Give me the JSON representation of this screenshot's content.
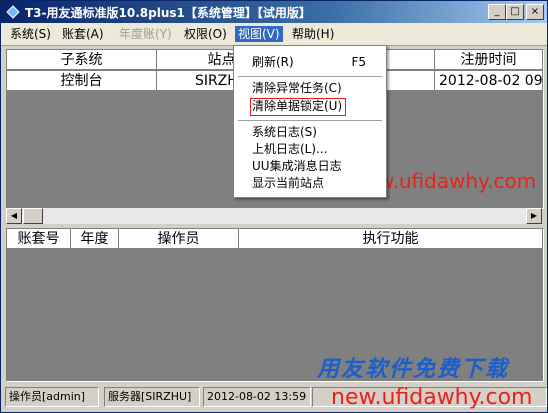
{
  "window": {
    "title": "T3-用友通标准版10.8plus1【系统管理】【试用版】",
    "buttons": {
      "minimize": "_",
      "maximize": "□",
      "close": "×"
    }
  },
  "menubar": {
    "items": [
      {
        "label": "系统(S)",
        "enabled": true
      },
      {
        "label": "账套(A)",
        "enabled": true
      },
      {
        "label": "年度账(Y)",
        "enabled": false
      },
      {
        "label": "权限(O)",
        "enabled": true
      },
      {
        "label": "视图(V)",
        "enabled": true,
        "active": true
      },
      {
        "label": "帮助(H)",
        "enabled": true
      }
    ]
  },
  "view_menu": {
    "items": [
      {
        "label": "刷新(R)",
        "shortcut": "F5"
      },
      {
        "label": "清除异常任务(C)",
        "shortcut": ""
      },
      {
        "label": "清除单据锁定(U)",
        "shortcut": ""
      },
      {
        "label": "系统日志(S)",
        "shortcut": ""
      },
      {
        "label": "上机日志(L)...",
        "shortcut": ""
      },
      {
        "label": "UU集成消息日志",
        "shortcut": ""
      },
      {
        "label": "显示当前站点",
        "shortcut": ""
      }
    ]
  },
  "top_table": {
    "headers": [
      "子系统",
      "站点",
      "注册时间"
    ],
    "rows": [
      [
        "控制台",
        "SIRZHU",
        "2012-08-02 09"
      ]
    ]
  },
  "bottom_table": {
    "headers": [
      "账套号",
      "年度",
      "操作员",
      "执行功能"
    ]
  },
  "watermarks": {
    "url_top": "new.ufidawhy.com",
    "brand": "用友软件免费下载",
    "url_bottom": "new.ufidawhy.com"
  },
  "statusbar": {
    "operator": "操作员[admin]",
    "server": "服务器[SIRZHU]",
    "datetime": "2012-08-02 13:59"
  },
  "colors": {
    "title_bar": "#0a246a",
    "menu_active": "#316ac5",
    "highlight_box": "#e02020",
    "watermark_red": "#e8221b",
    "watermark_blue": "#1b5fc8"
  }
}
